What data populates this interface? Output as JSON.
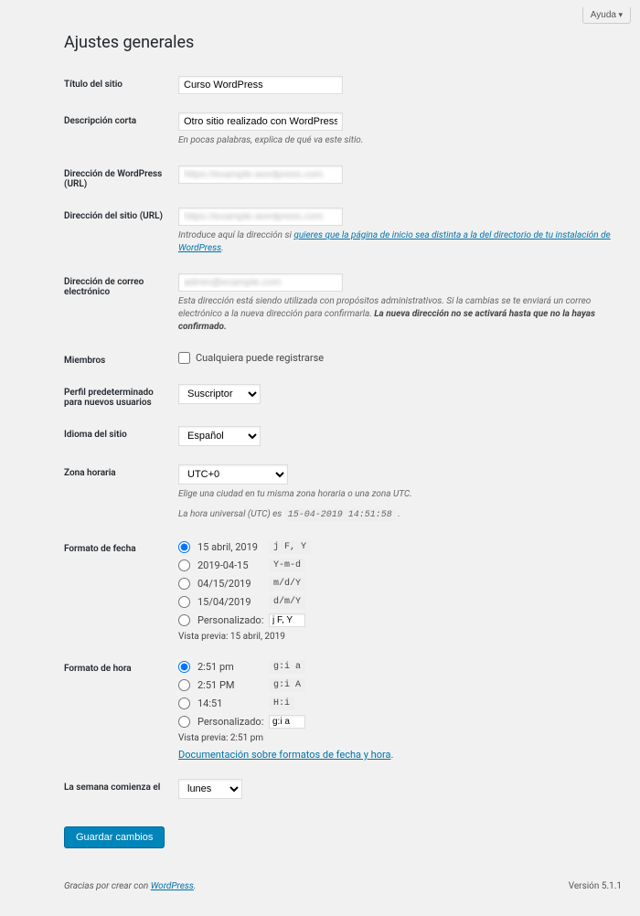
{
  "help": {
    "label": "Ayuda"
  },
  "page_title": "Ajustes generales",
  "fields": {
    "site_title": {
      "label": "Título del sitio",
      "value": "Curso WordPress"
    },
    "tagline": {
      "label": "Descripción corta",
      "value": "Otro sitio realizado con WordPress",
      "desc": "En pocas palabras, explica de qué va este sitio."
    },
    "wp_url": {
      "label": "Dirección de WordPress (URL)",
      "value": ""
    },
    "site_url": {
      "label": "Dirección del sitio (URL)",
      "value": "",
      "desc_pre": "Introduce aquí la dirección si ",
      "desc_link": "quieres que la página de inicio sea distinta a la del directorio de tu instalación de WordPress",
      "desc_post": "."
    },
    "email": {
      "label": "Dirección de correo electrónico",
      "value": "",
      "desc": "Esta dirección está siendo utilizada con propósitos administrativos. Si la cambias se te enviará un correo electrónico a la nueva dirección para confirmarla. ",
      "desc_strong": "La nueva dirección no se activará hasta que no la hayas confirmado."
    },
    "membership": {
      "label": "Miembros",
      "checkbox": "Cualquiera puede registrarse"
    },
    "default_role": {
      "label": "Perfil predeterminado para nuevos usuarios",
      "value": "Suscriptor"
    },
    "language": {
      "label": "Idioma del sitio",
      "value": "Español"
    },
    "timezone": {
      "label": "Zona horaria",
      "value": "UTC+0",
      "desc": "Elige una ciudad en tu misma zona horaria o una zona UTC.",
      "utc_pre": "La hora universal (UTC) es ",
      "utc_code": "15-04-2019 14:51:58",
      "utc_post": " ."
    },
    "date_format": {
      "label": "Formato de fecha",
      "options": [
        {
          "label": "15 abril, 2019",
          "code": "j F, Y",
          "checked": true
        },
        {
          "label": "2019-04-15",
          "code": "Y-m-d"
        },
        {
          "label": "04/15/2019",
          "code": "m/d/Y"
        },
        {
          "label": "15/04/2019",
          "code": "d/m/Y"
        }
      ],
      "custom_label": "Personalizado:",
      "custom_value": "j F, Y",
      "preview_label": "Vista previa:",
      "preview_value": "15 abril, 2019"
    },
    "time_format": {
      "label": "Formato de hora",
      "options": [
        {
          "label": "2:51 pm",
          "code": "g:i a",
          "checked": true
        },
        {
          "label": "2:51 PM",
          "code": "g:i A"
        },
        {
          "label": "14:51",
          "code": "H:i"
        }
      ],
      "custom_label": "Personalizado:",
      "custom_value": "g:i a",
      "preview_label": "Vista previa:",
      "preview_value": "2:51 pm",
      "doc_link": "Documentación sobre formatos de fecha y hora"
    },
    "week_start": {
      "label": "La semana comienza el",
      "value": "lunes"
    }
  },
  "submit": {
    "label": "Guardar cambios"
  },
  "footer": {
    "thanks_pre": "Gracias por crear con ",
    "thanks_link": "WordPress",
    "thanks_post": ".",
    "version": "Versión 5.1.1"
  }
}
